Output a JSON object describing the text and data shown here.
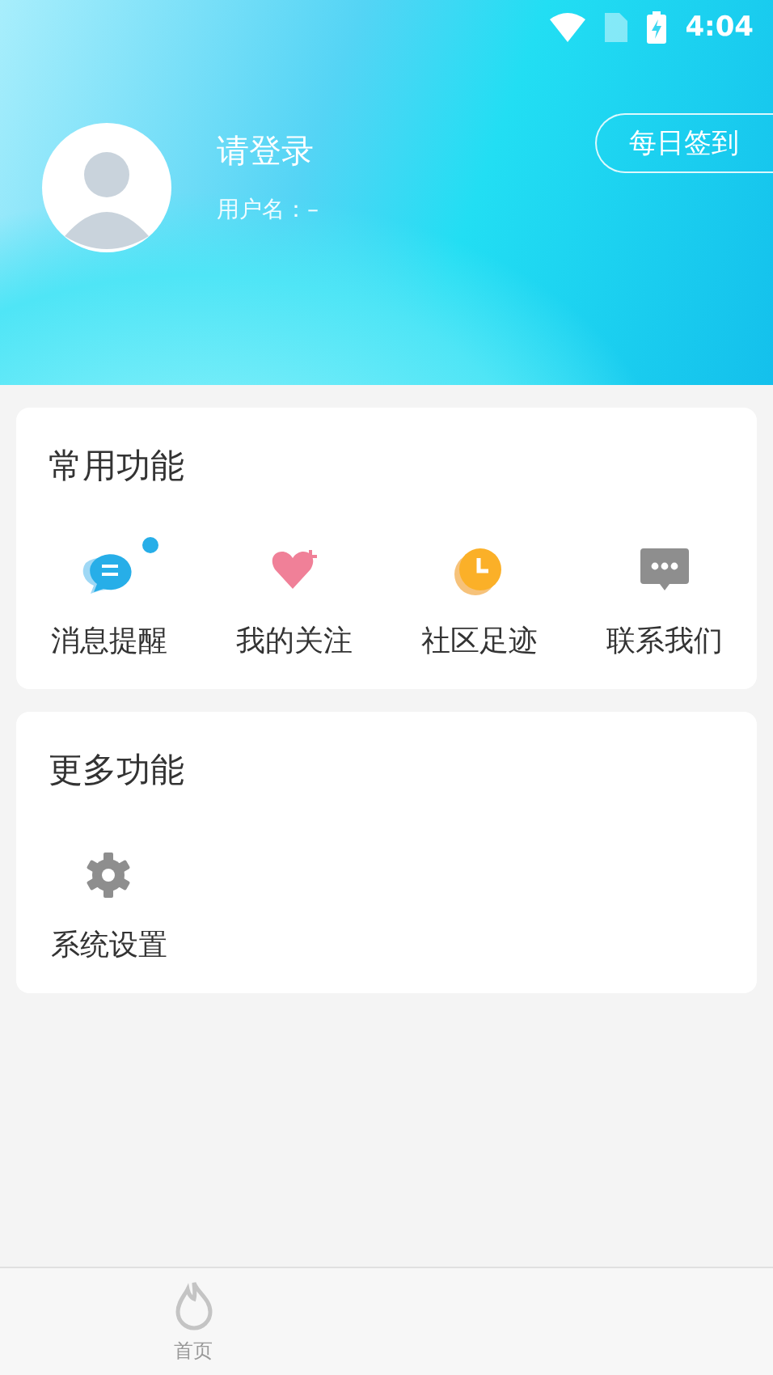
{
  "status_bar": {
    "time": "4:04"
  },
  "profile": {
    "title": "请登录",
    "username": "用户名：–",
    "checkin_button": "每日签到"
  },
  "sections": [
    {
      "title": "常用功能",
      "items": [
        {
          "label": "消息提醒",
          "dot": true
        },
        {
          "label": "我的关注",
          "dot": false
        },
        {
          "label": "社区足迹",
          "dot": false
        },
        {
          "label": "联系我们",
          "dot": false
        }
      ]
    },
    {
      "title": "更多功能",
      "items": [
        {
          "label": "系统设置",
          "dot": false
        }
      ]
    }
  ],
  "bottom_nav": [
    {
      "label": "首页",
      "selected": false
    }
  ]
}
